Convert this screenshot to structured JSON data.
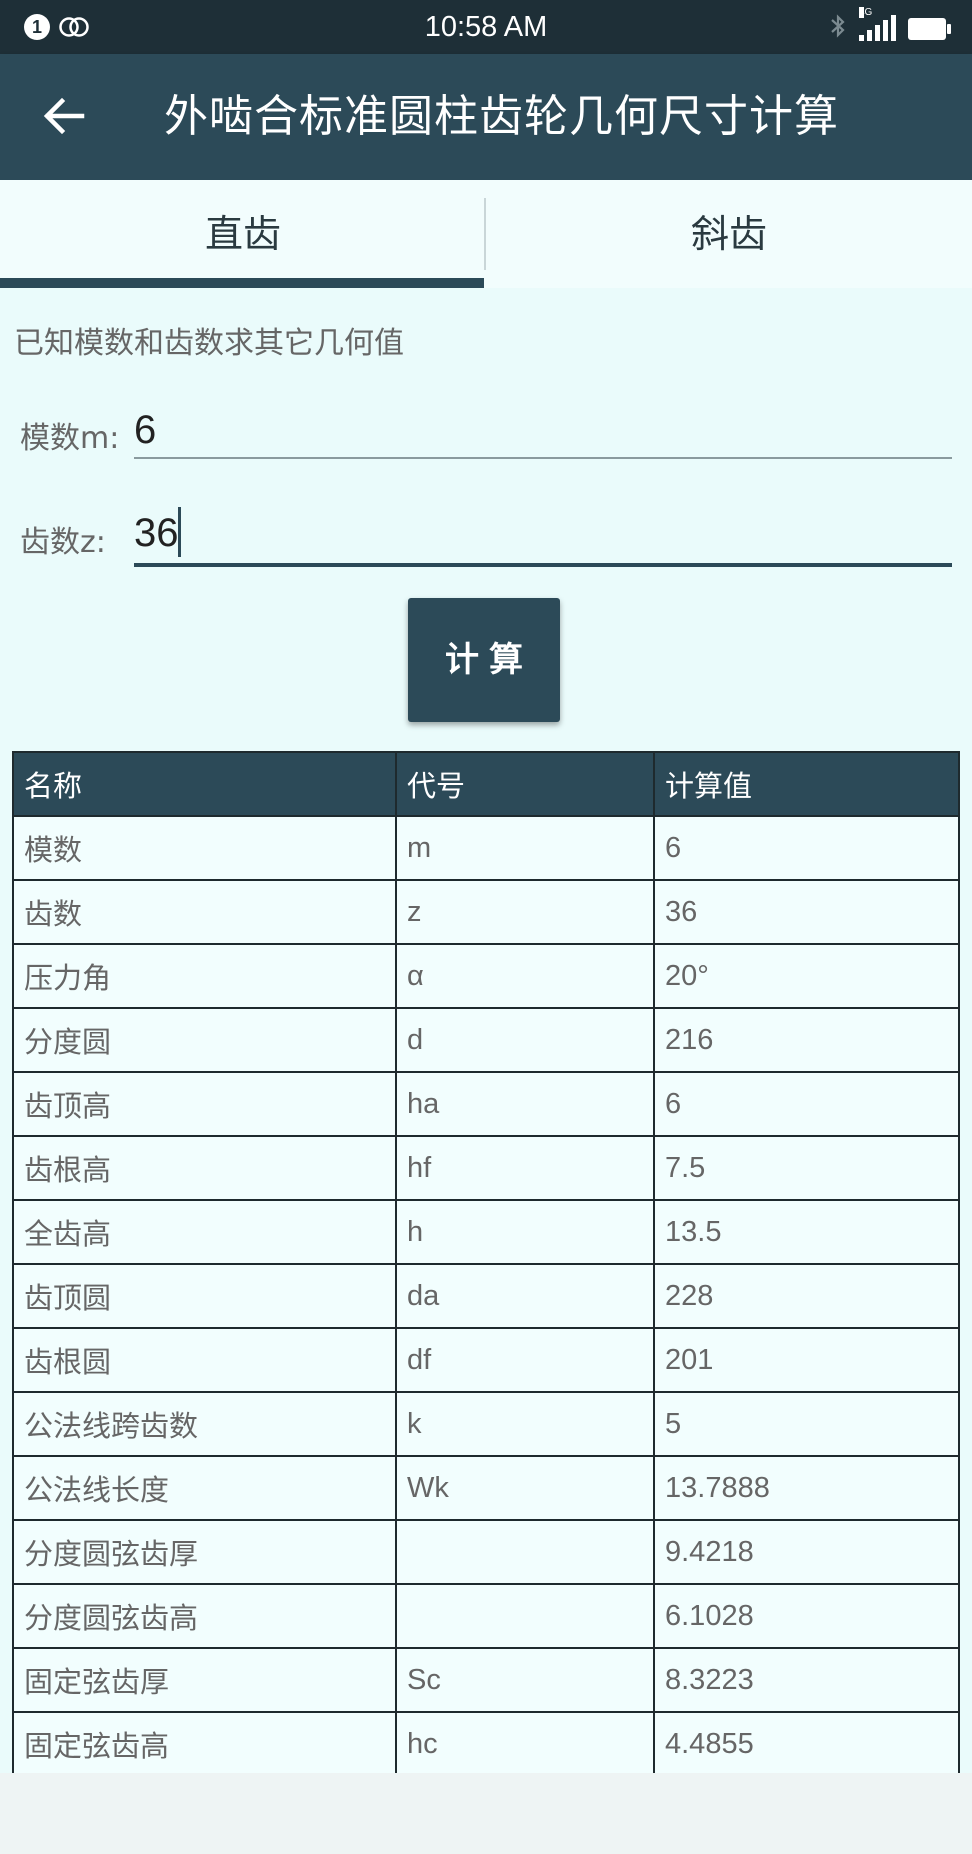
{
  "status_bar": {
    "time": "10:58 AM",
    "notification_count": "1",
    "network_type": "4G"
  },
  "app_bar": {
    "title": "外啮合标准圆柱齿轮几何尺寸计算",
    "back_icon": "arrow-left-icon"
  },
  "tabs": [
    {
      "label": "直齿",
      "selected": true
    },
    {
      "label": "斜齿",
      "selected": false
    }
  ],
  "form": {
    "hint": "已知模数和齿数求其它几何值",
    "module_label": "模数m:",
    "module_value": "6",
    "teeth_label": "齿数z:",
    "teeth_value": "36",
    "calc_button": "计算"
  },
  "table": {
    "headers": [
      "名称",
      "代号",
      "计算值"
    ],
    "rows": [
      [
        "模数",
        "m",
        "6"
      ],
      [
        "齿数",
        "z",
        "36"
      ],
      [
        "压力角",
        "α",
        "20°"
      ],
      [
        "分度圆",
        "d",
        "216"
      ],
      [
        "齿顶高",
        "ha",
        "6"
      ],
      [
        "齿根高",
        "hf",
        "7.5"
      ],
      [
        "全齿高",
        "h",
        "13.5"
      ],
      [
        "齿顶圆",
        "da",
        "228"
      ],
      [
        "齿根圆",
        "df",
        "201"
      ],
      [
        "公法线跨齿数",
        "k",
        "5"
      ],
      [
        "公法线长度",
        "Wk",
        "13.7888"
      ],
      [
        "分度圆弦齿厚",
        "",
        "9.4218"
      ],
      [
        "分度圆弦齿高",
        "",
        "6.1028"
      ],
      [
        "固定弦齿厚",
        "Sc",
        "8.3223"
      ],
      [
        "固定弦齿高",
        "hc",
        "4.4855"
      ]
    ]
  },
  "colors": {
    "primary": "#2c4a58",
    "status_bar": "#1e2f37",
    "background": "#eafbfb"
  }
}
